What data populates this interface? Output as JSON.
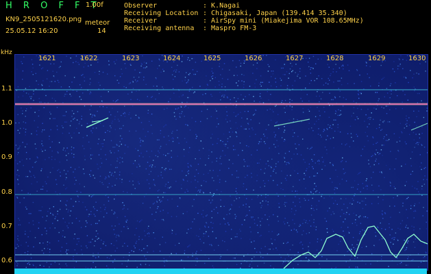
{
  "header": {
    "app_title": "H R O F F T",
    "version": "1.00f",
    "filename": "KN9_2505121620.png",
    "datetime": "25.05.12 16:20",
    "meteor_label": "meteor",
    "meteor_count": "14"
  },
  "meta": [
    {
      "label": "Observer",
      "value": ": K.Nagai"
    },
    {
      "label": "Receiving Location",
      "value": ": Chigasaki, Japan (139.414 35.340)"
    },
    {
      "label": "Receiver",
      "value": ": AirSpy mini (Miakejima VOR 108.65MHz)"
    },
    {
      "label": "Receiving antenna",
      "value": ": Maspro FM-3"
    }
  ],
  "axes": {
    "y_unit": "kHz",
    "y_ticks": [
      "1.1",
      "1.0",
      "0.9",
      "0.8",
      "0.7",
      "0.6"
    ],
    "x_ticks": [
      "1621",
      "1622",
      "1623",
      "1624",
      "1625",
      "1626",
      "1627",
      "1628",
      "1629",
      "1630"
    ]
  },
  "colors": {
    "background": "#000000",
    "spectrogram": "#0d1a66",
    "text": "#ffd24a",
    "title": "#33ff66",
    "carrier": "#ff66cc",
    "trace": "#8fffd0",
    "strip": "#22d3f2"
  }
}
